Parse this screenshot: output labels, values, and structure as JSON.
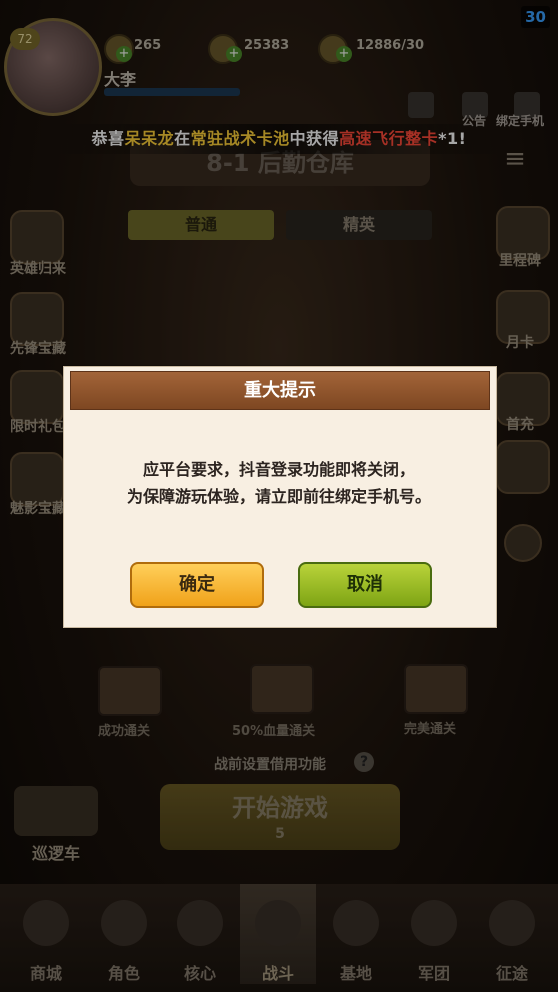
{
  "top_bar": {
    "level": "72",
    "resources": [
      {
        "icon": "coin-icon",
        "value": "265"
      },
      {
        "icon": "gold-icon",
        "value": "25383"
      },
      {
        "icon": "drumstick-icon",
        "value": "12886/30"
      }
    ],
    "username": "大李",
    "fps": "30",
    "right_icons": [
      {
        "icon": "notice-icon",
        "label": "公告"
      },
      {
        "icon": "phone-icon",
        "label": "绑定手机"
      }
    ]
  },
  "banner": {
    "prefix": "恭喜",
    "player": "呆呆龙",
    "middle1": "在",
    "pool": "常驻战术卡池",
    "middle2": "中获得",
    "item": "高速飞行整卡",
    "suffix": "*1!"
  },
  "stage": {
    "title": "8-1 后勤仓库",
    "tabs": [
      "普通",
      "精英"
    ]
  },
  "left_side": [
    {
      "icon": "hero-icon",
      "label": "英雄归来"
    },
    {
      "icon": "pioneer-treasure-icon",
      "label": "先锋宝藏"
    },
    {
      "icon": "limited-gift-icon",
      "label": "限时礼包"
    },
    {
      "icon": "shadow-treasure-icon",
      "label": "魅影宝藏"
    }
  ],
  "right_side": [
    {
      "icon": "milestone-icon",
      "label": "里程碑"
    },
    {
      "icon": "month-card-icon",
      "label": "月卡"
    },
    {
      "icon": "first-charge-icon",
      "label": "首充"
    }
  ],
  "modal": {
    "title": "重大提示",
    "message_line1": "应平台要求，抖音登录功能即将关闭，",
    "message_line2": "为保障游玩体验，请立即前往绑定手机号。",
    "confirm_label": "确定",
    "cancel_label": "取消"
  },
  "stage_bottom": {
    "chests": [
      "成功通关",
      "50%血量通关",
      "完美通关"
    ],
    "preset_label": "战前设置借用功能",
    "start_label": "开始游戏",
    "cost": "5",
    "patrol_label": "巡逻车"
  },
  "bottom_nav": [
    {
      "icon": "shop-icon",
      "label": "商城"
    },
    {
      "icon": "character-icon",
      "label": "角色"
    },
    {
      "icon": "core-icon",
      "label": "核心"
    },
    {
      "icon": "battle-icon",
      "label": "战斗",
      "active": true
    },
    {
      "icon": "base-icon",
      "label": "基地"
    },
    {
      "icon": "legion-icon",
      "label": "军团"
    },
    {
      "icon": "expedition-icon",
      "label": "征途"
    }
  ]
}
